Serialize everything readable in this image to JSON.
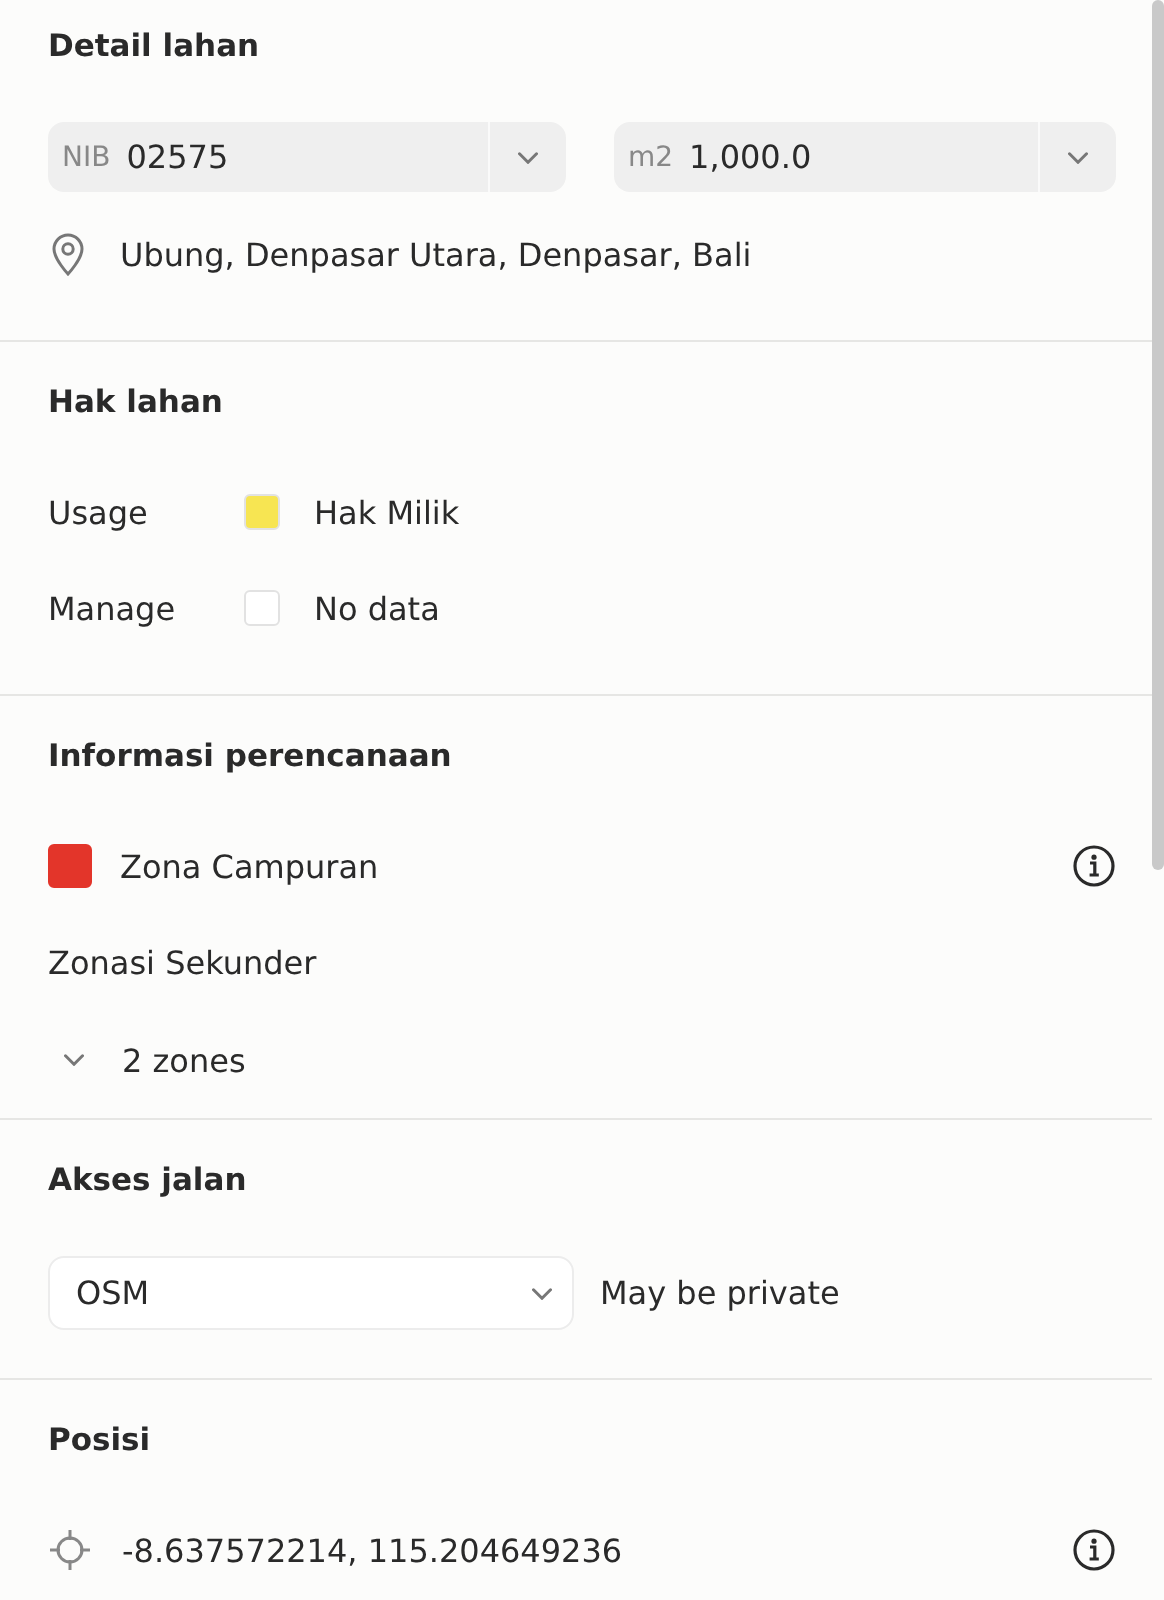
{
  "sections": [
    {
      "kind": "detail",
      "title": "Detail lahan",
      "fields": [
        {
          "prefix": "NIB",
          "value": "02575"
        },
        {
          "prefix": "m2",
          "value": "1,000.0"
        }
      ],
      "location": "Ubung, Denpasar Utara, Denpasar, Bali"
    },
    {
      "kind": "rights",
      "title": "Hak lahan",
      "rows": [
        {
          "label": "Usage",
          "value": "Hak Milik",
          "color": "#f7e552"
        },
        {
          "label": "Manage",
          "value": "No data",
          "color": "#ffffff"
        }
      ]
    },
    {
      "kind": "planning",
      "title": "Informasi perencanaan",
      "zone": {
        "name": "Zona Campuran",
        "color": "#e3352a"
      },
      "secondary_label": "Zonasi Sekunder",
      "secondary": {
        "label": "2 zones",
        "expanded": false
      }
    },
    {
      "kind": "road",
      "title": "Akses jalan",
      "source": {
        "value": "OSM"
      },
      "note": "May be private"
    },
    {
      "kind": "position",
      "title": "Posisi",
      "coordinates": "-8.637572214, 115.204649236"
    }
  ]
}
